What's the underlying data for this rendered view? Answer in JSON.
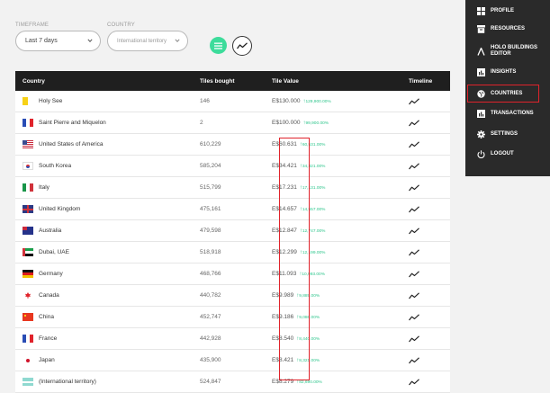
{
  "filters": {
    "timeframe": {
      "label": "TIMEFRAME",
      "value": "Last 7 days"
    },
    "country": {
      "label": "COUNTRY",
      "value": "International territory"
    }
  },
  "table": {
    "headers": {
      "country": "Country",
      "tiles": "Tiles bought",
      "value": "Tile Value",
      "timeline": "Timeline"
    },
    "rows": [
      {
        "country": "Holy See",
        "tiles": "146",
        "value": "E$130.000",
        "gain": "129,900.00%"
      },
      {
        "country": "Saint Pierre and Miquelon",
        "tiles": "2",
        "value": "E$100.000",
        "gain": "99,900.00%"
      },
      {
        "country": "United States of America",
        "tiles": "610,229",
        "value": "E$60.631",
        "gain": "60,531.00%"
      },
      {
        "country": "South Korea",
        "tiles": "585,204",
        "value": "E$34.421",
        "gain": "34,321.00%"
      },
      {
        "country": "Italy",
        "tiles": "515,799",
        "value": "E$17.231",
        "gain": "17,131.00%"
      },
      {
        "country": "United Kingdom",
        "tiles": "475,161",
        "value": "E$14.657",
        "gain": "14,557.00%"
      },
      {
        "country": "Australia",
        "tiles": "479,598",
        "value": "E$12.847",
        "gain": "12,747.00%"
      },
      {
        "country": "Dubai, UAE",
        "tiles": "518,918",
        "value": "E$12.299",
        "gain": "12,199.00%"
      },
      {
        "country": "Germany",
        "tiles": "468,766",
        "value": "E$11.093",
        "gain": "10,993.00%"
      },
      {
        "country": "Canada",
        "tiles": "440,782",
        "value": "E$9.989",
        "gain": "9,889.00%"
      },
      {
        "country": "China",
        "tiles": "452,747",
        "value": "E$9.186",
        "gain": "9,086.00%"
      },
      {
        "country": "France",
        "tiles": "442,928",
        "value": "E$8.540",
        "gain": "8,440.00%"
      },
      {
        "country": "Japan",
        "tiles": "435,900",
        "value": "E$8.421",
        "gain": "8,321.00%"
      },
      {
        "country": "(International territory)",
        "tiles": "524,847",
        "value": "E$8.279",
        "gain": "82,690.00%"
      }
    ]
  },
  "sidebar": {
    "items": [
      {
        "label": "PROFILE",
        "icon": "profile-icon"
      },
      {
        "label": "RESOURCES",
        "icon": "resources-icon"
      },
      {
        "label": "HOLO BUILDINGS EDITOR",
        "icon": "holo-editor-icon"
      },
      {
        "label": "INSIGHTS",
        "icon": "insights-icon"
      },
      {
        "label": "COUNTRIES",
        "icon": "globe-icon"
      },
      {
        "label": "TRANSACTIONS",
        "icon": "transactions-icon"
      },
      {
        "label": "SETTINGS",
        "icon": "gear-icon"
      },
      {
        "label": "LOGOUT",
        "icon": "power-icon"
      }
    ]
  },
  "colors": {
    "accent": "#3ddc9b",
    "gain": "#2fc58c",
    "highlight": "#e0232b",
    "sidebar": "#2a2a2a",
    "header": "#1f1f1f"
  }
}
